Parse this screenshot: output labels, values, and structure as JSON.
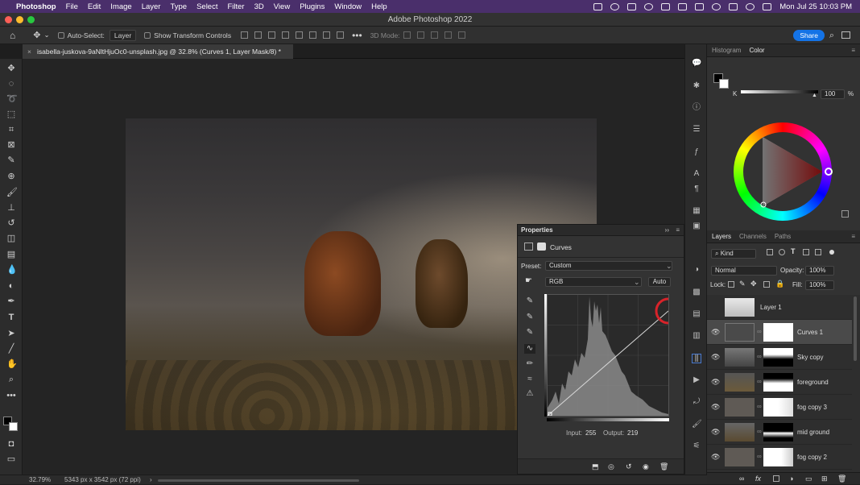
{
  "menubar": {
    "app": "Photoshop",
    "items": [
      "File",
      "Edit",
      "Image",
      "Layer",
      "Type",
      "Select",
      "Filter",
      "3D",
      "View",
      "Plugins",
      "Window",
      "Help"
    ],
    "datetime": "Mon Jul 25  10:03 PM"
  },
  "window": {
    "title": "Adobe Photoshop 2022"
  },
  "options": {
    "auto_select_label": "Auto-Select:",
    "auto_select_value": "Layer",
    "transform_label": "Show Transform Controls",
    "mode3d_label": "3D Mode:",
    "share_label": "Share"
  },
  "document": {
    "tab_title": "isabella-juskova-9aNltHjuOc0-unsplash.jpg @ 32.8% (Curves 1, Layer Mask/8) *",
    "zoom": "32.79%",
    "info": "5343 px x 3542 px (72 ppi)"
  },
  "properties": {
    "title": "Properties",
    "adjustment": "Curves",
    "preset_label": "Preset:",
    "preset_value": "Custom",
    "channel": "RGB",
    "auto_label": "Auto",
    "input_label": "Input:",
    "input_value": "255",
    "output_label": "Output:",
    "output_value": "219"
  },
  "color_panel": {
    "tabs": [
      "Histogram",
      "Color"
    ],
    "active_tab": "Color",
    "k_label": "K",
    "k_value": "100",
    "k_unit": "%",
    "fill_fraction": 0.97
  },
  "layers_panel": {
    "tabs": [
      "Layers",
      "Channels",
      "Paths"
    ],
    "kind_label": "Kind",
    "blend_mode": "Normal",
    "opacity_label": "Opacity:",
    "opacity_value": "100%",
    "lock_label": "Lock:",
    "fill_label": "Fill:",
    "fill_value": "100%",
    "layers": [
      {
        "name": "Layer 1",
        "visible": false
      },
      {
        "name": "Curves 1",
        "visible": true
      },
      {
        "name": "Sky copy",
        "visible": true
      },
      {
        "name": "foreground",
        "visible": true
      },
      {
        "name": "fog copy 3",
        "visible": true
      },
      {
        "name": "mid ground",
        "visible": true
      },
      {
        "name": "fog copy 2",
        "visible": true
      }
    ]
  },
  "colors": {
    "accent": "#1473e6",
    "highlight_circle": "#d8232a",
    "menubar": "#4a2f6b"
  }
}
